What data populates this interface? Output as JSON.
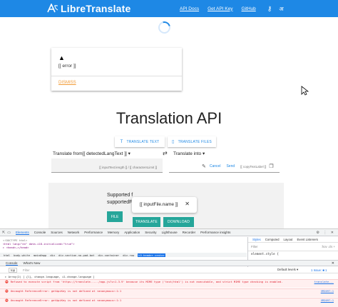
{
  "navbar": {
    "brand": "LibreTranslate",
    "links": [
      "API Docs",
      "Get API Key",
      "GitHub"
    ],
    "key_icon": "key-icon",
    "lang_icon": "translate-icon",
    "color": "#1e88e5"
  },
  "error_card": {
    "message": "[[ error ]]",
    "dismiss": "DISMISS"
  },
  "title": "Translation API",
  "modes": {
    "text": "TRANSLATE TEXT",
    "files": "TRANSLATE FILES"
  },
  "translator": {
    "from_label": "Translate from[[ detectedLangText ]]",
    "to_label": "Translate into",
    "source_meta": "[[ inputText.length ]] / [[ charactersLimit ]]",
    "cancel": "Cancel",
    "send": "Send",
    "copy_label": "[[ copyTextLabel ]]"
  },
  "files": {
    "supported_1": "Supported f",
    "supported_2": "supportedFi",
    "file_button": "FILE",
    "chip_label": "[[ inputFile.name ]]",
    "translate_button": "TRANSLATE",
    "download_button": "DOWNLOAD",
    "accent": "#26a69a"
  },
  "devtools": {
    "tabs": [
      "Elements",
      "Console",
      "Sources",
      "Network",
      "Performance",
      "Memory",
      "Application",
      "Security",
      "Lighthouse",
      "Recorder",
      "Performance insights"
    ],
    "elements_lines": [
      "<!DOCTYPE html>",
      "<html lang=\"en\" data-i18-initialized=\"true\">",
      "▸ <head>…</head>"
    ],
    "breadcrumbs": [
      "html",
      "body.white",
      "main#app",
      "div",
      "div.section.no-pad-bot",
      "div.container",
      "div.row",
      "h3.header.center"
    ],
    "styles_tabs": [
      "Styles",
      "Computed",
      "Layout",
      "Event Listeners"
    ],
    "styles_filter": "Filter",
    "styles_filter_right": ":hov .cls +",
    "styles_line": "element.style {",
    "drawer_tabs": [
      "Console",
      "What's New"
    ],
    "console_context": "top",
    "console_filter": "Filter",
    "console_levels": "Default levels ▾",
    "console_issue": "1 Issue: ■ 1",
    "logs": [
      {
        "text": "▸ Array(2) [ {l}, change-language, i1.change-language ]",
        "src": ""
      },
      {
        "text": "Refused to execute script from 'https://translate...../app.js?v=1.3.9' because its MIME type ('text/html') is not executable, and strict MIME type checking is enabled.",
        "src": "translate..."
      },
      {
        "text": "Uncaught ReferenceError: getApiKey is not defined   at <anonymous>:1:1",
        "src": "VM2097:1"
      },
      {
        "text": "Uncaught ReferenceError: getApiKey is not defined   at <anonymous>:1:1",
        "src": "VM2097:1"
      }
    ]
  }
}
